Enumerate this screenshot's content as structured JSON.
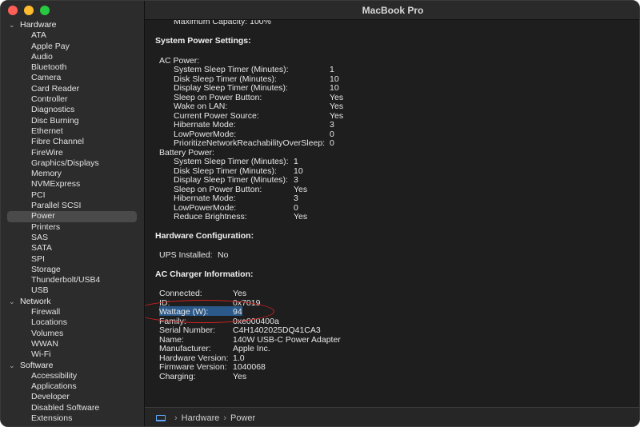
{
  "window": {
    "title": "MacBook Pro"
  },
  "sidebar": {
    "groups": [
      {
        "label": "Hardware",
        "items": [
          "ATA",
          "Apple Pay",
          "Audio",
          "Bluetooth",
          "Camera",
          "Card Reader",
          "Controller",
          "Diagnostics",
          "Disc Burning",
          "Ethernet",
          "Fibre Channel",
          "FireWire",
          "Graphics/Displays",
          "Memory",
          "NVMExpress",
          "PCI",
          "Parallel SCSI",
          "Power",
          "Printers",
          "SAS",
          "SATA",
          "SPI",
          "Storage",
          "Thunderbolt/USB4",
          "USB"
        ]
      },
      {
        "label": "Network",
        "items": [
          "Firewall",
          "Locations",
          "Volumes",
          "WWAN",
          "Wi-Fi"
        ]
      },
      {
        "label": "Software",
        "items": [
          "Accessibility",
          "Applications",
          "Developer",
          "Disabled Software",
          "Extensions"
        ]
      }
    ],
    "selected": "Power"
  },
  "content": {
    "top_partial": "Maximum Capacity:  100%",
    "system_power_title": "System Power Settings:",
    "ac_power_label": "AC Power:",
    "ac_power": [
      {
        "k": "System Sleep Timer (Minutes):",
        "v": "1"
      },
      {
        "k": "Disk Sleep Timer (Minutes):",
        "v": "10"
      },
      {
        "k": "Display Sleep Timer (Minutes):",
        "v": "10"
      },
      {
        "k": "Sleep on Power Button:",
        "v": "Yes"
      },
      {
        "k": "Wake on LAN:",
        "v": "Yes"
      },
      {
        "k": "Current Power Source:",
        "v": "Yes"
      },
      {
        "k": "Hibernate Mode:",
        "v": "3"
      },
      {
        "k": "LowPowerMode:",
        "v": "0"
      },
      {
        "k": "PrioritizeNetworkReachabilityOverSleep:",
        "v": "0"
      }
    ],
    "battery_power_label": "Battery Power:",
    "battery_power": [
      {
        "k": "System Sleep Timer (Minutes):",
        "v": "1"
      },
      {
        "k": "Disk Sleep Timer (Minutes):",
        "v": "10"
      },
      {
        "k": "Display Sleep Timer (Minutes):",
        "v": "3"
      },
      {
        "k": "Sleep on Power Button:",
        "v": "Yes"
      },
      {
        "k": "Hibernate Mode:",
        "v": "3"
      },
      {
        "k": "LowPowerMode:",
        "v": "0"
      },
      {
        "k": "Reduce Brightness:",
        "v": "Yes"
      }
    ],
    "hardware_config_title": "Hardware Configuration:",
    "ups": {
      "k": "UPS Installed:",
      "v": "No"
    },
    "ac_charger_title": "AC Charger Information:",
    "ac_charger": [
      {
        "k": "Connected:",
        "v": "Yes"
      },
      {
        "k": "ID:",
        "v": "0x7019"
      },
      {
        "k": "Wattage (W):",
        "v": "94"
      },
      {
        "k": "Family:",
        "v": "0xe000400a"
      },
      {
        "k": "Serial Number:",
        "v": "C4H1402025DQ41CA3"
      },
      {
        "k": "Name:",
        "v": "140W USB-C Power Adapter"
      },
      {
        "k": "Manufacturer:",
        "v": "Apple Inc."
      },
      {
        "k": "Hardware Version:",
        "v": "1.0"
      },
      {
        "k": "Firmware Version:",
        "v": "1040068"
      },
      {
        "k": "Charging:",
        "v": "Yes"
      }
    ]
  },
  "pathbar": {
    "crumbs": [
      "Hardware",
      "Power"
    ],
    "sep": "›"
  },
  "icons": {
    "traffic_lights": [
      "close-icon",
      "minimize-icon",
      "zoom-icon"
    ],
    "computer": "laptop-icon",
    "chevron": "chevron-down-icon"
  },
  "colors": {
    "selection": "#4a4a4a",
    "highlight": "#2b5a8a",
    "annotation": "#d32020"
  }
}
